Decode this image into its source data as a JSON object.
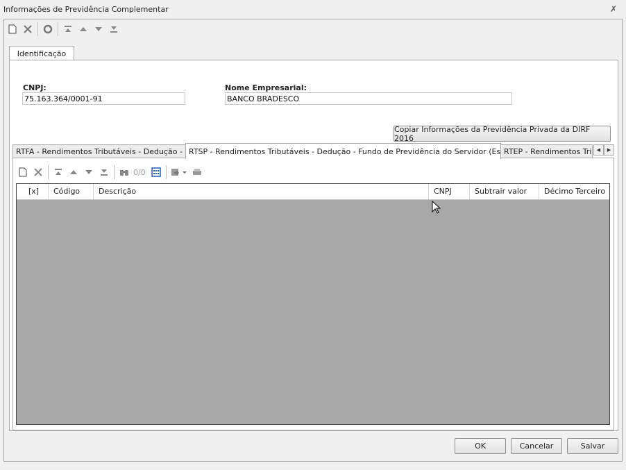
{
  "window": {
    "title": "Informações de Previdência Complementar"
  },
  "main_tab": {
    "label": "Identificação"
  },
  "cnpj": {
    "label": "CNPJ:",
    "value": "75.163.364/0001-91"
  },
  "nome": {
    "label": "Nome Empresarial:",
    "value": "BANCO BRADESCO"
  },
  "copy_button": {
    "label": "Copiar Informações da Previdência Privada da DIRF 2016"
  },
  "subtabs": [
    {
      "label": "RTFA - Rendimentos Tributáveis - Dedução - FAPI"
    },
    {
      "label": "RTSP - Rendimentos Tributáveis - Dedução - Fundo de Previdência do Servidor (Estatutário)"
    },
    {
      "label": "RTEP - Rendimentos Tributáveis - Dedução - Entidade"
    }
  ],
  "grid_toolbar": {
    "counter": "0/0"
  },
  "grid": {
    "columns": [
      "[x]",
      "Código",
      "Descrição",
      "CNPJ",
      "Subtrair valor",
      "Décimo Terceiro"
    ]
  },
  "footer": {
    "ok": "OK",
    "cancel": "Cancelar",
    "save": "Salvar"
  },
  "colors": {
    "grid_empty": "#a8a8a8",
    "accent_icon": "#1f5fbf"
  }
}
